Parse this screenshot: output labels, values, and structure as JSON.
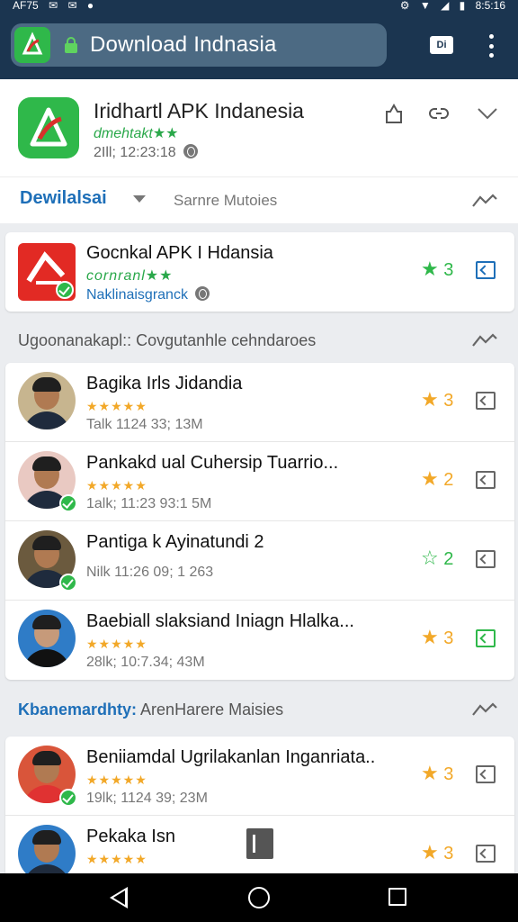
{
  "status_bar": {
    "left": [
      "AF75",
      "✉",
      "✉",
      "●"
    ],
    "right": [
      "⚙",
      "▼",
      "◢",
      "▮",
      "8:5:16"
    ]
  },
  "browser": {
    "url_text": "Download Indnasia",
    "tab_count": "Di"
  },
  "header": {
    "title": "Iridhartl APK Indanesia",
    "subtitle": "dmehtakt★★",
    "meta": "2Ill; 12:23:18",
    "tab_active": "Dewilalsai",
    "tab_other": "Sarnre Mutoies"
  },
  "featured": {
    "title": "Gocnkal APK I Hdansia",
    "subtitle": "cornranl★★",
    "meta": "Naklinaisgranck",
    "rating": "3"
  },
  "section1": {
    "title": "Ugoonanakapl:: Covgutanhle cehndaroes"
  },
  "list1": [
    {
      "title": "Bagika Irls Jidandia",
      "stars": "★★★★★",
      "meta": "Talk 1124 33; 13M",
      "rating": "3"
    },
    {
      "title": "Pankakd ual Cuhersip Tuarrio...",
      "stars": "★★★★★",
      "meta": "1alk; 11:23 93:1 5M",
      "rating": "2"
    },
    {
      "title": "Pantiga k Ayinatundi 2",
      "stars": "",
      "meta": "Nilk 11:26 09; 1 263",
      "rating": "2"
    },
    {
      "title": "Baebiall slaksiand Iniagn Hlalka...",
      "stars": "★★★★★",
      "meta": "28lk; 10:7.34; 43M",
      "rating": "3"
    }
  ],
  "section2": {
    "prefix": "Kbanemardhty:",
    "title": "ArenHarere Maisies"
  },
  "list2": [
    {
      "title": "Beniiamdal Ugrilakanlan Inganriata..",
      "stars": "★★★★★",
      "meta": "19lk; 1124 39; 23M",
      "rating": "3"
    },
    {
      "title": "Pekaka Isn",
      "stars": "★★★★★",
      "meta": "",
      "rating": "3"
    }
  ],
  "colors": {
    "app_bar": "#1b3550",
    "accent_blue": "#1e6fb8",
    "accent_green": "#2fb84a",
    "star": "#f2a828"
  },
  "icons": {
    "site_logo": "app-logo-icon",
    "lock": "lock-icon",
    "tabs": "tabs-icon",
    "menu": "menu-icon",
    "share": "share-icon",
    "link": "link-icon",
    "expand": "chevron-down-icon",
    "globe": "globe-icon",
    "trend": "trending-icon",
    "open": "open-icon",
    "verified": "verified-check-icon"
  }
}
